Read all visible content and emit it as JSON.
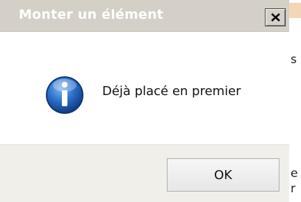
{
  "dialog": {
    "title": "Monter un élément",
    "message": "Déjà placé en premier",
    "ok_label": "OK",
    "icon": "information-icon"
  },
  "background_window": {
    "visible_chars": [
      "s",
      "e",
      "r"
    ]
  },
  "colors": {
    "titlebar": "#d4d0c8",
    "title_text": "#ffffff",
    "button_bar": "#f0efea",
    "info_icon": "#1e5fb4"
  }
}
